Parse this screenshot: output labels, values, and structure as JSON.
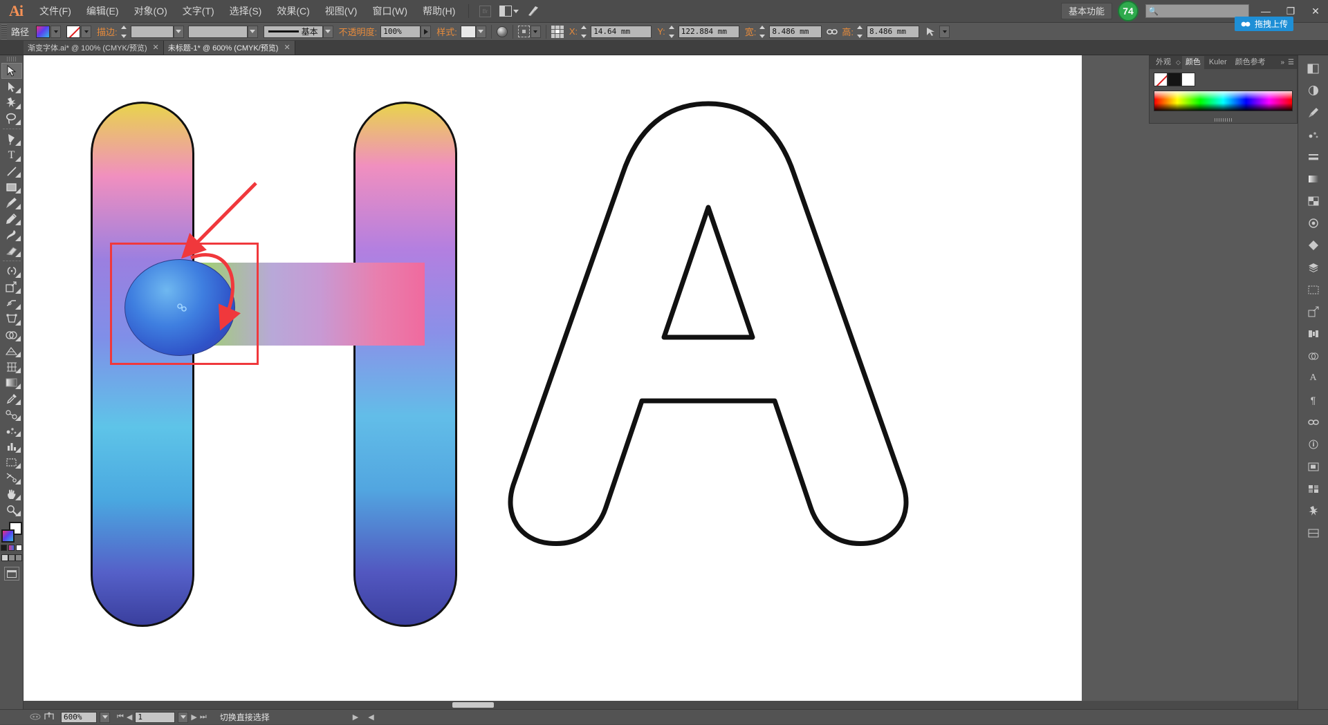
{
  "app": {
    "logo": "Ai",
    "workspace": "基本功能",
    "notification_count": "74",
    "search_placeholder": "",
    "drag_upload_label": "拖拽上传"
  },
  "menubar": {
    "items": [
      {
        "label": "文件(F)"
      },
      {
        "label": "编辑(E)"
      },
      {
        "label": "对象(O)"
      },
      {
        "label": "文字(T)"
      },
      {
        "label": "选择(S)"
      },
      {
        "label": "效果(C)"
      },
      {
        "label": "视图(V)"
      },
      {
        "label": "窗口(W)"
      },
      {
        "label": "帮助(H)"
      }
    ],
    "bridge_icon": "Br",
    "arrange_icon": "arrange-documents-icon",
    "window_controls": {
      "minimize": "—",
      "maximize": "❐",
      "close": "✕"
    }
  },
  "controlbar": {
    "object_type": "路径",
    "fill_label": "fill-swatch",
    "stroke_label": "描边:",
    "stroke_weight": "",
    "stroke_profile": "基本",
    "opacity_label": "不透明度:",
    "opacity_value": "100%",
    "style_label": "样式:",
    "x_label": "X:",
    "x_value": "14.64 mm",
    "y_label": "Y:",
    "y_value": "122.884 mm",
    "w_label": "宽:",
    "w_value": "8.486 mm",
    "h_label": "高:",
    "h_value": "8.486 mm",
    "link_icon": "chain-link-icon"
  },
  "tabs": [
    {
      "title": "渐变字体.ai* @ 100% (CMYK/预览)",
      "close": "✕",
      "active": false
    },
    {
      "title": "未标题-1* @ 600% (CMYK/预览)",
      "close": "✕",
      "active": true
    }
  ],
  "toolbox": {
    "tools": [
      {
        "name": "selection-tool",
        "glyph": "➤",
        "active": true
      },
      {
        "name": "direct-selection-tool",
        "glyph": "➤",
        "active": false
      },
      {
        "name": "magic-wand-tool",
        "glyph": "✳",
        "active": false
      },
      {
        "name": "lasso-tool",
        "glyph": "◠",
        "active": false
      },
      {
        "name": "pen-tool",
        "glyph": "✒",
        "active": false
      },
      {
        "name": "type-tool",
        "glyph": "T",
        "active": false
      },
      {
        "name": "line-segment-tool",
        "glyph": "／",
        "active": false
      },
      {
        "name": "rectangle-tool",
        "glyph": "▭",
        "active": false
      },
      {
        "name": "paintbrush-tool",
        "glyph": "🖌",
        "active": false
      },
      {
        "name": "pencil-tool",
        "glyph": "✏",
        "active": false
      },
      {
        "name": "blob-brush-tool",
        "glyph": "✑",
        "active": false
      },
      {
        "name": "eraser-tool",
        "glyph": "◻",
        "active": false
      },
      {
        "name": "rotate-tool",
        "glyph": "↻",
        "active": false
      },
      {
        "name": "scale-tool",
        "glyph": "⤢",
        "active": false
      },
      {
        "name": "width-tool",
        "glyph": "⌇",
        "active": false
      },
      {
        "name": "free-transform-tool",
        "glyph": "⛶",
        "active": false
      },
      {
        "name": "shape-builder-tool",
        "glyph": "◍",
        "active": false
      },
      {
        "name": "perspective-grid-tool",
        "glyph": "⊞",
        "active": false
      },
      {
        "name": "mesh-tool",
        "glyph": "⌗",
        "active": false
      },
      {
        "name": "gradient-tool",
        "glyph": "▨",
        "active": false
      },
      {
        "name": "eyedropper-tool",
        "glyph": "⚲",
        "active": false
      },
      {
        "name": "blend-tool",
        "glyph": "⦿",
        "active": false
      },
      {
        "name": "symbol-sprayer-tool",
        "glyph": "❋",
        "active": false
      },
      {
        "name": "column-graph-tool",
        "glyph": "▥",
        "active": false
      },
      {
        "name": "artboard-tool",
        "glyph": "⬚",
        "active": false
      },
      {
        "name": "slice-tool",
        "glyph": "✂",
        "active": false
      },
      {
        "name": "hand-tool",
        "glyph": "✋",
        "active": false
      },
      {
        "name": "zoom-tool",
        "glyph": "⚲",
        "active": false
      }
    ],
    "screen_mode": "screen-mode-button"
  },
  "color_panel": {
    "tabs": [
      {
        "label": "外观",
        "active": false
      },
      {
        "label": "颜色",
        "active": true
      },
      {
        "label": "Kuler",
        "active": false
      },
      {
        "label": "颜色参考",
        "active": false
      }
    ],
    "menu_icon": "panel-menu-icon",
    "collapse_icon": "panel-collapse-icon",
    "swatches": [
      "none",
      "black",
      "white"
    ]
  },
  "right_dock": {
    "icons": [
      {
        "name": "color-panel-icon",
        "glyph": "◧"
      },
      {
        "name": "color-guide-icon",
        "glyph": "◑"
      },
      {
        "name": "brushes-panel-icon",
        "glyph": "🖌"
      },
      {
        "name": "symbols-panel-icon",
        "glyph": "❋"
      },
      {
        "name": "stroke-panel-icon",
        "glyph": "▤"
      },
      {
        "name": "gradient-panel-icon",
        "glyph": "▥"
      },
      {
        "name": "transparency-panel-icon",
        "glyph": "◨"
      },
      {
        "name": "appearance-panel-icon",
        "glyph": "◉"
      },
      {
        "name": "graphic-styles-icon",
        "glyph": "◆"
      },
      {
        "name": "layers-panel-icon",
        "glyph": "▤"
      },
      {
        "name": "artboards-panel-icon",
        "glyph": "⬚"
      },
      {
        "name": "transform-panel-icon",
        "glyph": "⤢"
      },
      {
        "name": "align-panel-icon",
        "glyph": "⫴"
      },
      {
        "name": "pathfinder-panel-icon",
        "glyph": "◍"
      },
      {
        "name": "character-panel-icon",
        "glyph": "A"
      },
      {
        "name": "paragraph-panel-icon",
        "glyph": "¶"
      },
      {
        "name": "links-panel-icon",
        "glyph": "🔗"
      },
      {
        "name": "document-info-icon",
        "glyph": "ⓘ"
      },
      {
        "name": "navigator-panel-icon",
        "glyph": "⬔"
      },
      {
        "name": "separator-panel-icon",
        "glyph": "▦"
      },
      {
        "name": "swatches-panel-icon",
        "glyph": "▩"
      },
      {
        "name": "magic-wand-panel-icon",
        "glyph": "✳"
      }
    ]
  },
  "statusbar": {
    "zoom_value": "600%",
    "page_value": "1",
    "status_text": "切换直接选择",
    "nav_first": "⏮",
    "nav_prev": "◀",
    "nav_next": "▶",
    "nav_last": "⏭",
    "expand_arrow": "▶",
    "collapse_arrow": "◀"
  },
  "canvas": {
    "letters": [
      "H",
      "H",
      "A"
    ],
    "annotation": "red-selection-rectangle",
    "selected_object": "sphere-3d-object"
  }
}
